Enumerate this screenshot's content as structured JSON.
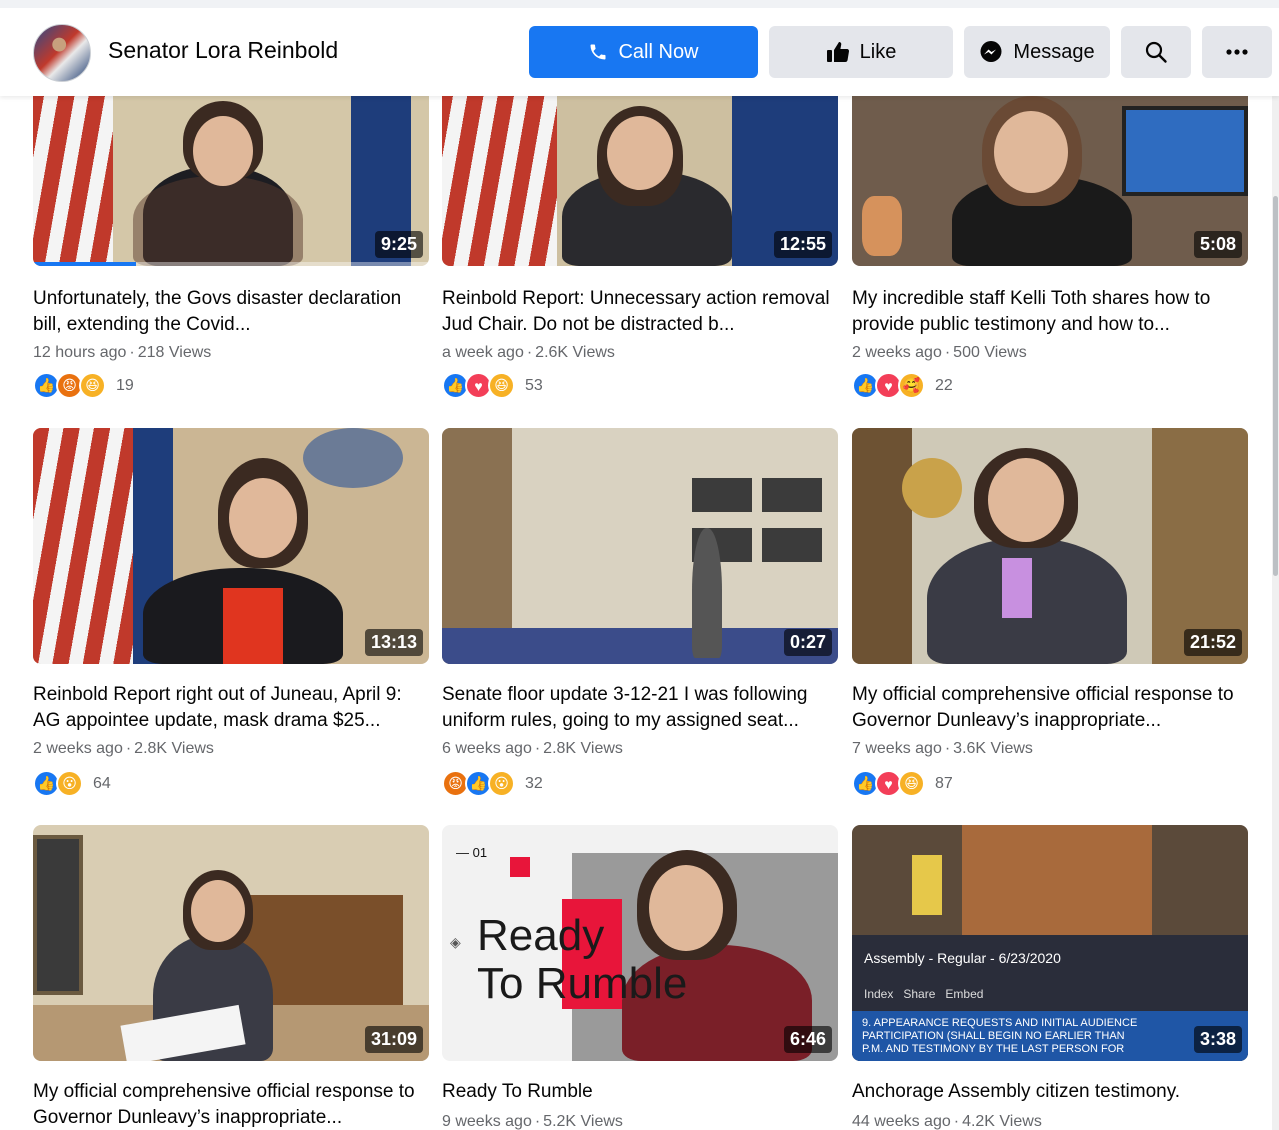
{
  "header": {
    "page_name": "Senator Lora Reinbold",
    "call_label": "Call Now",
    "like_label": "Like",
    "message_label": "Message"
  },
  "icons": {
    "phone": "phone-icon",
    "like": "thumbs-up-icon",
    "message": "messenger-icon",
    "search": "search-icon",
    "more": "more-horizontal-icon"
  },
  "colors": {
    "primary": "#1877f2",
    "secondary_button": "#e4e6eb",
    "meta_text": "#65676b"
  },
  "videos": [
    {
      "duration": "9:25",
      "title": "Unfortunately, the Govs disaster declaration bill, extending the Covid...",
      "age": "12 hours ago",
      "views": "218 Views",
      "reactions": [
        "like",
        "angry",
        "haha"
      ],
      "reaction_count": "19",
      "watched_fraction": 0.26
    },
    {
      "duration": "12:55",
      "title": "Reinbold Report: Unnecessary action removal Jud Chair. Do not be distracted b...",
      "age": "a week ago",
      "views": "2.6K Views",
      "reactions": [
        "like",
        "love",
        "haha"
      ],
      "reaction_count": "53"
    },
    {
      "duration": "5:08",
      "title": "My incredible staff Kelli Toth shares how to provide public testimony and how to...",
      "age": "2 weeks ago",
      "views": "500 Views",
      "reactions": [
        "like",
        "love",
        "care"
      ],
      "reaction_count": "22"
    },
    {
      "duration": "13:13",
      "title": "Reinbold Report right out of Juneau, April 9: AG appointee update, mask drama $25...",
      "age": "2 weeks ago",
      "views": "2.8K Views",
      "reactions": [
        "like",
        "wow"
      ],
      "reaction_count": "64"
    },
    {
      "duration": "0:27",
      "title": "Senate floor update 3-12-21 I was following uniform rules, going to my assigned seat...",
      "age": "6 weeks ago",
      "views": "2.8K Views",
      "reactions": [
        "angry",
        "like",
        "wow"
      ],
      "reaction_count": "32"
    },
    {
      "duration": "21:52",
      "title": "My official comprehensive official response to Governor Dunleavy’s inappropriate...",
      "age": "7 weeks ago",
      "views": "3.6K Views",
      "reactions": [
        "like",
        "love",
        "haha"
      ],
      "reaction_count": "87"
    },
    {
      "duration": "31:09",
      "title": "My official comprehensive official response to Governor Dunleavy’s inappropriate...",
      "age": "",
      "views": "",
      "reactions": [],
      "reaction_count": ""
    },
    {
      "duration": "6:46",
      "title": "Ready To Rumble",
      "age": "9 weeks ago",
      "views": "5.2K Views",
      "reactions": [],
      "reaction_count": "",
      "thumb_text": {
        "index": "01",
        "line1": "Ready",
        "line2": "To Rumble"
      }
    },
    {
      "duration": "3:38",
      "title": "Anchorage Assembly citizen testimony.",
      "age": "44 weeks ago",
      "views": "4.2K Views",
      "reactions": [],
      "reaction_count": "",
      "thumb_text": {
        "meeting": "Assembly - Regular - 6/23/2020",
        "tab1": "Index",
        "tab2": "Share",
        "tab3": "Embed",
        "agenda1": "9. APPEARANCE REQUESTS AND INITIAL AUDIENCE",
        "agenda2": "PARTICIPATION (SHALL BEGIN NO EARLIER THAN",
        "agenda3": "P.M. AND TESTIMONY BY THE LAST PERSON FOR"
      }
    }
  ]
}
